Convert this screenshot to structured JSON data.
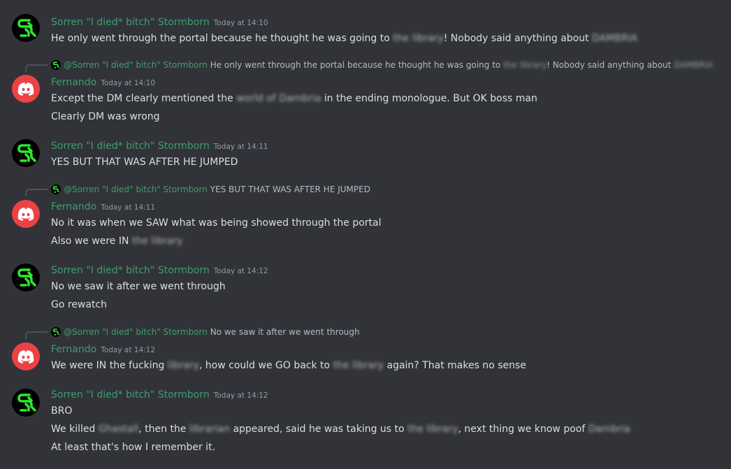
{
  "colors": {
    "background": "#313338",
    "sorren_name": "#3e9e6e",
    "fernando_name": "#3e9e6e",
    "fernando_avatar": "#ed4245",
    "sorren_logo": "#2ee82e"
  },
  "messages": [
    {
      "author": "Sorren \"I died* bitch\" Stormborn",
      "timestamp": "Today at 14:10",
      "lines": [
        [
          "He only went through the portal because he thought he was going to ",
          "the library",
          "! Nobody said anything about ",
          "DAMBRIA"
        ]
      ]
    },
    {
      "reply": {
        "author": "@Sorren \"I died\" bitch\" Stormborn",
        "text": [
          "He only went through the portal because he thought he was going to ",
          "the library",
          "! Nobody said anything about ",
          "DAMBRIA"
        ]
      },
      "author": "Fernando",
      "timestamp": "Today at 14:10",
      "lines": [
        [
          "Except the DM clearly mentioned the ",
          "world of Dambria",
          " in the ending monologue. But OK boss man"
        ],
        [
          "Clearly DM was wrong"
        ]
      ]
    },
    {
      "author": "Sorren \"I died* bitch\" Stormborn",
      "timestamp": "Today at 14:11",
      "lines": [
        [
          "YES BUT THAT WAS AFTER HE JUMPED"
        ]
      ]
    },
    {
      "reply": {
        "author": "@Sorren \"I died\" bitch\" Stormborn",
        "text": [
          "YES BUT THAT WAS AFTER HE JUMPED"
        ]
      },
      "author": "Fernando",
      "timestamp": "Today at 14:11",
      "lines": [
        [
          "No it was when we SAW what was being showed through the portal"
        ],
        [
          "Also we were IN ",
          "the library"
        ]
      ]
    },
    {
      "author": "Sorren \"I died* bitch\" Stormborn",
      "timestamp": "Today at 14:12",
      "lines": [
        [
          "No we saw it after we went through"
        ],
        [
          "Go rewatch"
        ]
      ]
    },
    {
      "reply": {
        "author": "@Sorren \"I died\" bitch\" Stormborn",
        "text": [
          "No we saw it after we went through"
        ]
      },
      "author": "Fernando",
      "timestamp": "Today at 14:12",
      "lines": [
        [
          "We were IN the fucking ",
          "library",
          ", how could we GO back to ",
          "the library",
          " again? That makes no sense"
        ]
      ]
    },
    {
      "author": "Sorren \"I died* bitch\" Stormborn",
      "timestamp": "Today at 14:12",
      "lines": [
        [
          "BRO"
        ],
        [
          "We killed ",
          "Ghastall",
          ", then the ",
          "librarian",
          " appeared, said he was taking us to ",
          "the library",
          ", next thing we know poof ",
          "Dambria"
        ],
        [
          "At least that's how I remember it."
        ]
      ]
    }
  ]
}
